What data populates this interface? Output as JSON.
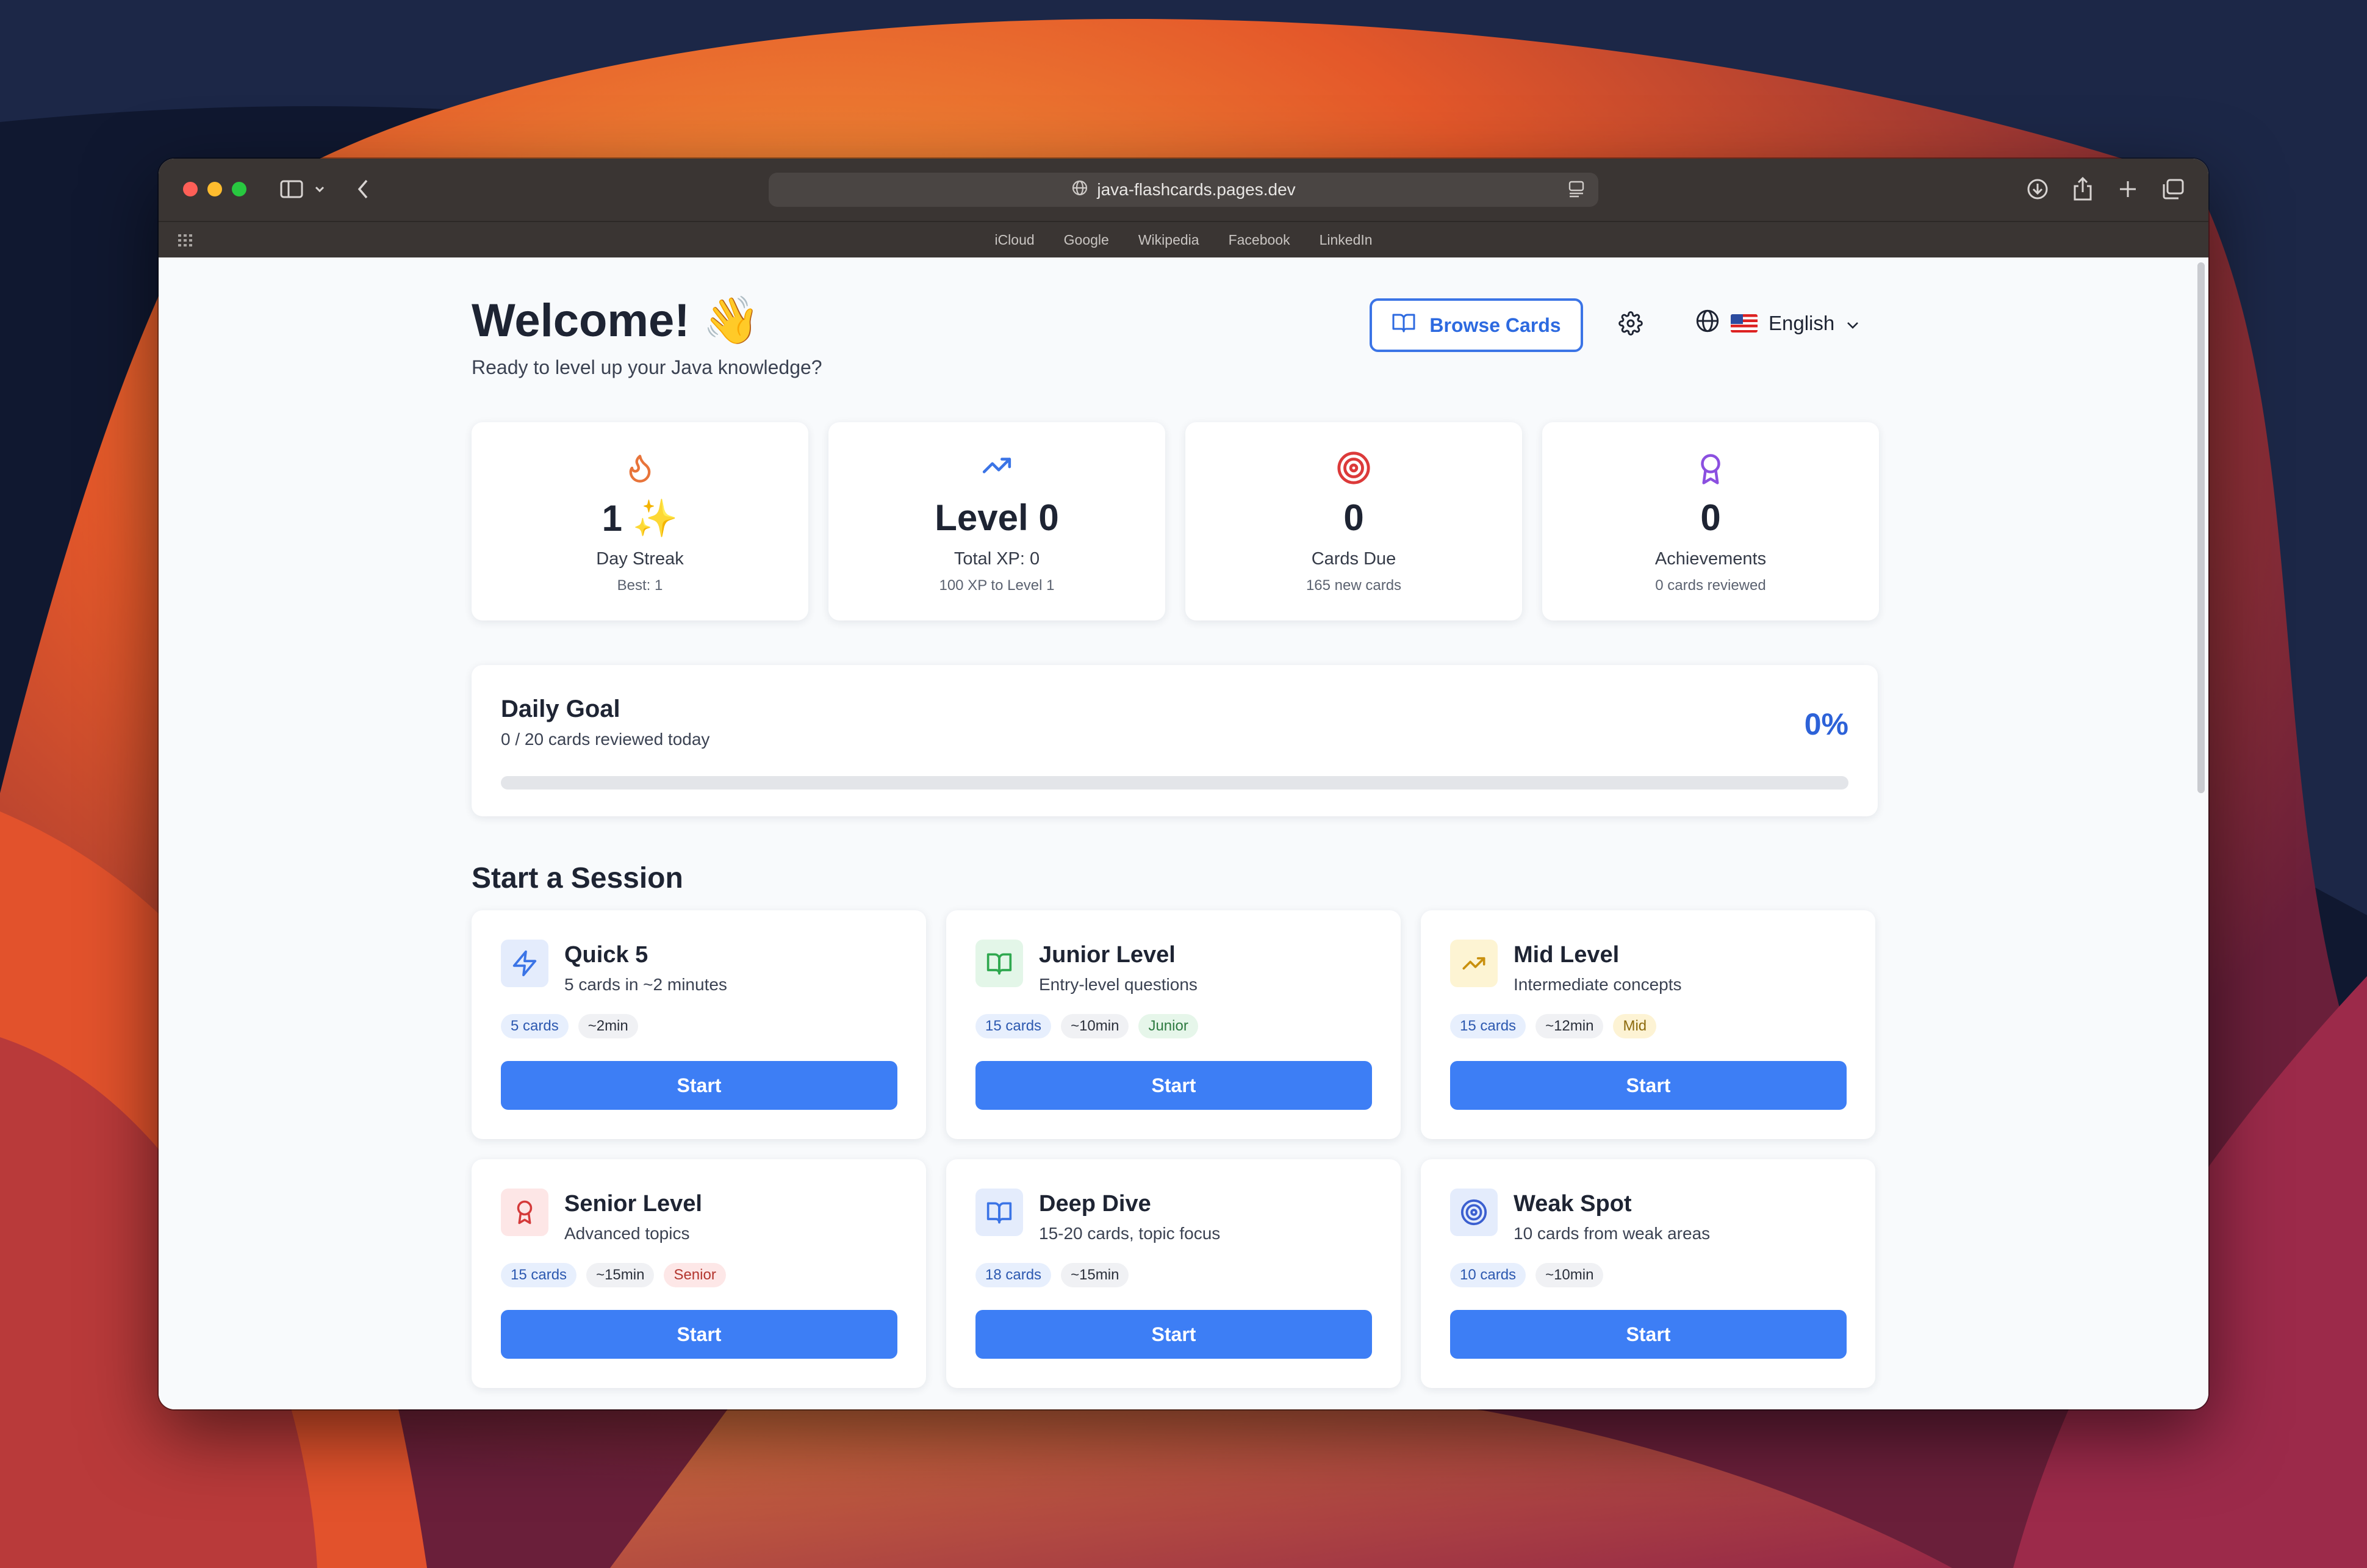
{
  "browser": {
    "url": "java-flashcards.pages.dev",
    "favorites": [
      "iCloud",
      "Google",
      "Wikipedia",
      "Facebook",
      "LinkedIn"
    ]
  },
  "header": {
    "title": "Welcome! 👋",
    "subtitle": "Ready to level up your Java knowledge?",
    "browse_label": "Browse Cards",
    "language": "English"
  },
  "stats": [
    {
      "value": "1 ✨",
      "label": "Day Streak",
      "sub": "Best: 1",
      "icon": "flame-icon"
    },
    {
      "value": "Level 0",
      "label": "Total XP: 0",
      "sub": "100 XP to Level 1",
      "icon": "trending-up-icon"
    },
    {
      "value": "0",
      "label": "Cards Due",
      "sub": "165 new cards",
      "icon": "target-icon"
    },
    {
      "value": "0",
      "label": "Achievements",
      "sub": "0 cards reviewed",
      "icon": "award-icon"
    }
  ],
  "daily_goal": {
    "title": "Daily Goal",
    "subtitle": "0 / 20 cards reviewed today",
    "percent_label": "0%",
    "progress": 0
  },
  "sessions_title": "Start a Session",
  "sessions": [
    {
      "name": "Quick 5",
      "desc": "5 cards in ~2 minutes",
      "icon": "zap-icon",
      "tags": [
        {
          "text": "5 cards",
          "kind": "blue"
        },
        {
          "text": "~2min",
          "kind": "gray"
        }
      ],
      "start": "Start"
    },
    {
      "name": "Junior Level",
      "desc": "Entry-level questions",
      "icon": "book-open-icon",
      "tags": [
        {
          "text": "15 cards",
          "kind": "blue"
        },
        {
          "text": "~10min",
          "kind": "gray"
        },
        {
          "text": "Junior",
          "kind": "green"
        }
      ],
      "start": "Start"
    },
    {
      "name": "Mid Level",
      "desc": "Intermediate concepts",
      "icon": "trending-up-icon",
      "tags": [
        {
          "text": "15 cards",
          "kind": "blue"
        },
        {
          "text": "~12min",
          "kind": "gray"
        },
        {
          "text": "Mid",
          "kind": "yellow"
        }
      ],
      "start": "Start"
    },
    {
      "name": "Senior Level",
      "desc": "Advanced topics",
      "icon": "award-icon",
      "tags": [
        {
          "text": "15 cards",
          "kind": "blue"
        },
        {
          "text": "~15min",
          "kind": "gray"
        },
        {
          "text": "Senior",
          "kind": "red"
        }
      ],
      "start": "Start"
    },
    {
      "name": "Deep Dive",
      "desc": "15-20 cards, topic focus",
      "icon": "book-open-icon",
      "tags": [
        {
          "text": "18 cards",
          "kind": "blue"
        },
        {
          "text": "~15min",
          "kind": "gray"
        }
      ],
      "start": "Start"
    },
    {
      "name": "Weak Spot",
      "desc": "10 cards from weak areas",
      "icon": "target-icon",
      "tags": [
        {
          "text": "10 cards",
          "kind": "blue"
        },
        {
          "text": "~10min",
          "kind": "gray"
        }
      ],
      "start": "Start"
    }
  ],
  "colors": {
    "accent": "#3d7ef5",
    "flame": "#e8743a",
    "trend": "#3b74e6",
    "target": "#dc3a3a",
    "award": "#8b4fe0"
  }
}
